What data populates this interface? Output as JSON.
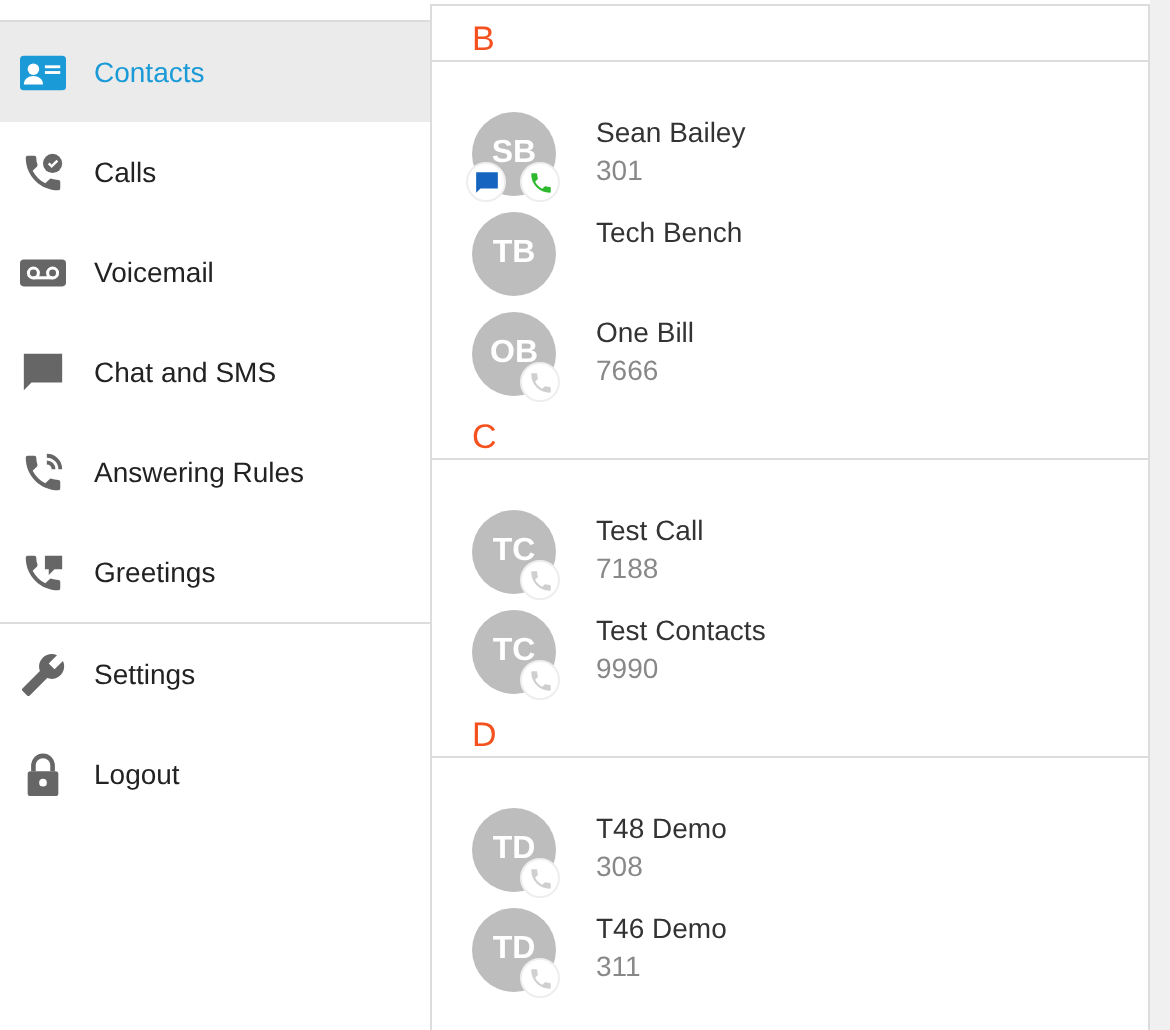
{
  "sidebar": {
    "groups": [
      {
        "items": [
          {
            "label": "Contacts",
            "kind": "contacts",
            "selected": true
          },
          {
            "label": "Calls",
            "kind": "calls",
            "selected": false
          },
          {
            "label": "Voicemail",
            "kind": "voicemail",
            "selected": false
          },
          {
            "label": "Chat and SMS",
            "kind": "chat",
            "selected": false
          },
          {
            "label": "Answering Rules",
            "kind": "rules",
            "selected": false
          },
          {
            "label": "Greetings",
            "kind": "greetings",
            "selected": false
          }
        ]
      },
      {
        "items": [
          {
            "label": "Settings",
            "kind": "settings",
            "selected": false
          },
          {
            "label": "Logout",
            "kind": "logout",
            "selected": false
          }
        ]
      }
    ]
  },
  "contacts": {
    "sections": [
      {
        "letter": "B",
        "rows": [
          {
            "initials": "SB",
            "name": "Sean Bailey",
            "number": "301",
            "badges": [
              {
                "kind": "chat",
                "active": true
              },
              {
                "kind": "phone",
                "active": true
              }
            ]
          },
          {
            "initials": "TB",
            "name": "Tech Bench",
            "badges": []
          },
          {
            "initials": "OB",
            "name": "One Bill",
            "number": "7666",
            "badges": [
              {
                "kind": "phone",
                "active": false
              }
            ]
          }
        ]
      },
      {
        "letter": "C",
        "rows": [
          {
            "initials": "TC",
            "name": "Test Call",
            "number": "7188",
            "badges": [
              {
                "kind": "phone",
                "active": false
              }
            ]
          },
          {
            "initials": "TC",
            "name": "Test Contacts",
            "number": "9990",
            "badges": [
              {
                "kind": "phone",
                "active": false
              }
            ]
          }
        ]
      },
      {
        "letter": "D",
        "rows": [
          {
            "initials": "TD",
            "name": "T48 Demo",
            "number": "308",
            "badges": [
              {
                "kind": "phone",
                "active": false
              }
            ]
          },
          {
            "initials": "TD",
            "name": "T46 Demo",
            "number": "311",
            "badges": [
              {
                "kind": "phone",
                "active": false
              }
            ]
          }
        ]
      }
    ]
  }
}
